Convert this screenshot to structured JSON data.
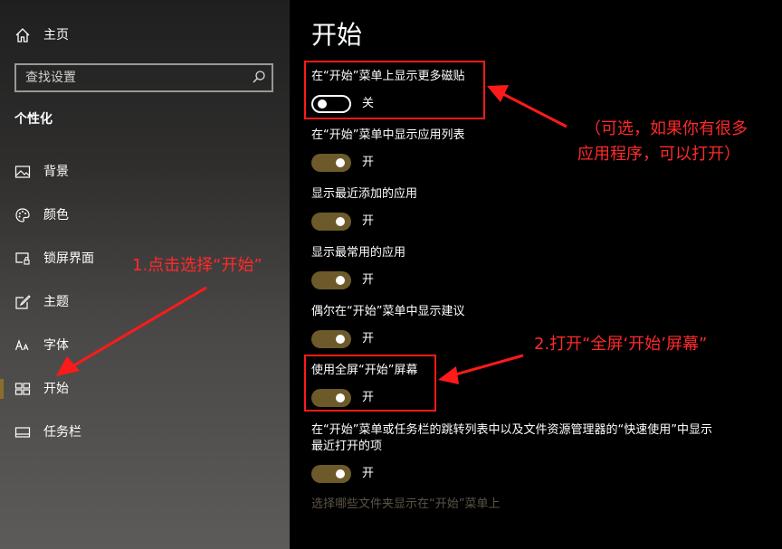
{
  "sidebar": {
    "home_label": "主页",
    "search_placeholder": "查找设置",
    "section_title": "个性化",
    "items": [
      {
        "label": "背景",
        "icon": "picture-icon"
      },
      {
        "label": "颜色",
        "icon": "palette-icon"
      },
      {
        "label": "锁屏界面",
        "icon": "lock-screen-icon"
      },
      {
        "label": "主题",
        "icon": "theme-brush-icon"
      },
      {
        "label": "字体",
        "icon": "font-icon"
      },
      {
        "label": "开始",
        "icon": "start-tiles-icon",
        "selected": true
      },
      {
        "label": "任务栏",
        "icon": "taskbar-icon"
      }
    ]
  },
  "main": {
    "title": "开始",
    "settings": [
      {
        "label": "在“开始”菜单上显示更多磁贴",
        "on": false,
        "state": "关"
      },
      {
        "label": "在“开始”菜单中显示应用列表",
        "on": true,
        "state": "开"
      },
      {
        "label": "显示最近添加的应用",
        "on": true,
        "state": "开"
      },
      {
        "label": "显示最常用的应用",
        "on": true,
        "state": "开"
      },
      {
        "label": "偶尔在“开始”菜单中显示建议",
        "on": true,
        "state": "开"
      },
      {
        "label": "使用全屏“开始”屏幕",
        "on": true,
        "state": "开"
      },
      {
        "label": "在“开始”菜单或任务栏的跳转列表中以及文件资源管理器的“快速使用”中显示最近打开的项",
        "on": true,
        "state": "开"
      }
    ],
    "link_text": "选择哪些文件夹显示在“开始”菜单上"
  },
  "annotations": {
    "step1": "1.点击选择“开始”",
    "note_line1": "（可选，如果你有很多",
    "note_line2": "应用程序，可以打开）",
    "step2": "2.打开“全屏‘开始’屏幕”",
    "color": "#ff1a1a"
  },
  "colors": {
    "accent": "#6d5a2b",
    "selected_indicator": "#8a6d2e",
    "link": "#5c5346"
  }
}
